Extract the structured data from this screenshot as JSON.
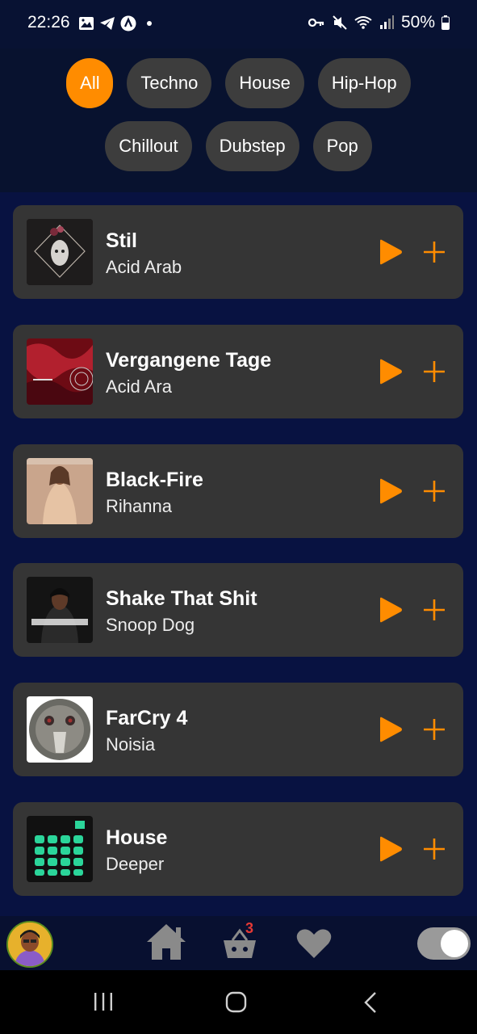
{
  "status_bar": {
    "time": "22:26",
    "battery": "50%",
    "left_icons": [
      "image-icon",
      "telegram-icon",
      "assistant-icon",
      "dot-icon"
    ],
    "right_icons": [
      "key-icon",
      "mute-icon",
      "wifi-icon",
      "signal-icon",
      "battery-icon"
    ]
  },
  "genres": {
    "row1": [
      "All",
      "Techno",
      "House",
      "Hip-Hop"
    ],
    "row2": [
      "Chillout",
      "Dubstep",
      "Pop"
    ],
    "active": "All"
  },
  "tracks": [
    {
      "title": "Stil",
      "artist": "Acid Arab"
    },
    {
      "title": "Vergangene Tage",
      "artist": "Acid Ara"
    },
    {
      "title": "Black-Fire",
      "artist": "Rihanna"
    },
    {
      "title": "Shake That Shit",
      "artist": "Snoop Dog"
    },
    {
      "title": "FarCry 4",
      "artist": "Noisia"
    },
    {
      "title": "House",
      "artist": "Deeper"
    }
  ],
  "bottom_nav": {
    "cart_badge": "3",
    "icons": [
      "avatar",
      "home-icon",
      "basket-icon",
      "heart-icon",
      "theme-toggle"
    ]
  },
  "colors": {
    "accent": "#ff8c00",
    "card": "#353535",
    "chip": "#3d3d3d",
    "background": "#081241"
  }
}
